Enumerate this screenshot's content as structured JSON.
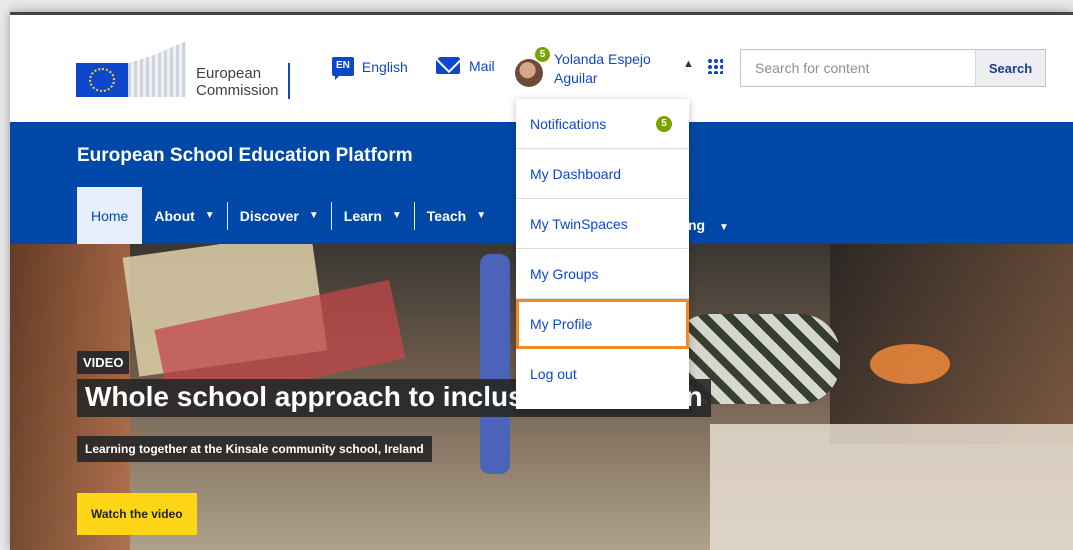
{
  "header": {
    "logo_text_line1": "European",
    "logo_text_line2": "Commission",
    "language_code": "EN",
    "language_label": "English",
    "mail_label": "Mail",
    "user_name": "Yolanda Espejo Aguilar",
    "notification_count": "5",
    "search_placeholder": "Search for content",
    "search_button": "Search"
  },
  "nav": {
    "platform_title": "European School Education Platform",
    "items": [
      {
        "label": "Home"
      },
      {
        "label": "About"
      },
      {
        "label": "Discover"
      },
      {
        "label": "Learn"
      },
      {
        "label": "Teach"
      }
    ],
    "tail_label": "ng"
  },
  "dropdown": {
    "items": [
      {
        "label": "Notifications",
        "badge": "5"
      },
      {
        "label": "My Dashboard"
      },
      {
        "label": "My TwinSpaces"
      },
      {
        "label": "My Groups"
      },
      {
        "label": "My Profile",
        "highlighted": true
      },
      {
        "label": "Log out"
      }
    ]
  },
  "hero": {
    "tag": "VIDEO",
    "headline": "Whole school approach to inclusive education",
    "subline": "Learning together at the Kinsale community school, Ireland",
    "cta": "Watch the video"
  },
  "colors": {
    "brand_blue": "#0048a8",
    "link_blue": "#0e47cb",
    "badge_green": "#7aa300",
    "cta_yellow": "#ffd617",
    "highlight_orange": "#f08a24"
  }
}
